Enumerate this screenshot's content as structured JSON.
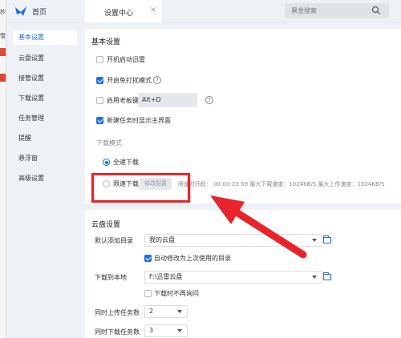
{
  "titlebar": {
    "home_label": "首页",
    "tab_label": "设置中心",
    "tab_close": "×",
    "search_placeholder": "黑金搜索"
  },
  "sidebar": {
    "items": [
      {
        "label": "基本设置",
        "active": true
      },
      {
        "label": "云盘设置"
      },
      {
        "label": "接管设置"
      },
      {
        "label": "下载设置"
      },
      {
        "label": "任务管理"
      },
      {
        "label": "提醒"
      },
      {
        "label": "悬浮窗"
      },
      {
        "label": "高级设置"
      }
    ]
  },
  "basic": {
    "title": "基本设置",
    "autostart": {
      "label": "开机启动迅雷",
      "checked": false
    },
    "no_disturb": {
      "label": "开启免打扰模式",
      "checked": true
    },
    "boss_key": {
      "label": "启用老板键",
      "checked": false,
      "value": "Alt+D"
    },
    "show_main": {
      "label": "新建任务时显示主界面",
      "checked": true
    },
    "download_mode_label": "下载模式",
    "full_speed": {
      "label": "全速下载",
      "selected": true
    },
    "limited": {
      "label": "限速下载",
      "button": "修改配置",
      "info": "限速时间段： 00:00-23:59  最大下载速度：1024KB/S  最大上传速度：1024KB/S"
    }
  },
  "cloud": {
    "title": "云盘设置",
    "default_dir_label": "默认添加目录",
    "default_dir_value": "我的云盘",
    "auto_modify": {
      "label": "自动修改为上次使用的目录",
      "checked": true
    },
    "download_to_label": "下载到本地",
    "download_to_value": "F:\\迅雷云盘",
    "no_ask": {
      "label": "下载时不再询问",
      "checked": false
    },
    "upload_count_label": "同时上传任务数",
    "upload_count_value": "2",
    "download_count_label": "同时下载任务数",
    "download_count_value": "3"
  },
  "colors": {
    "accent": "#1e6fe8",
    "highlight": "#e8242a"
  }
}
